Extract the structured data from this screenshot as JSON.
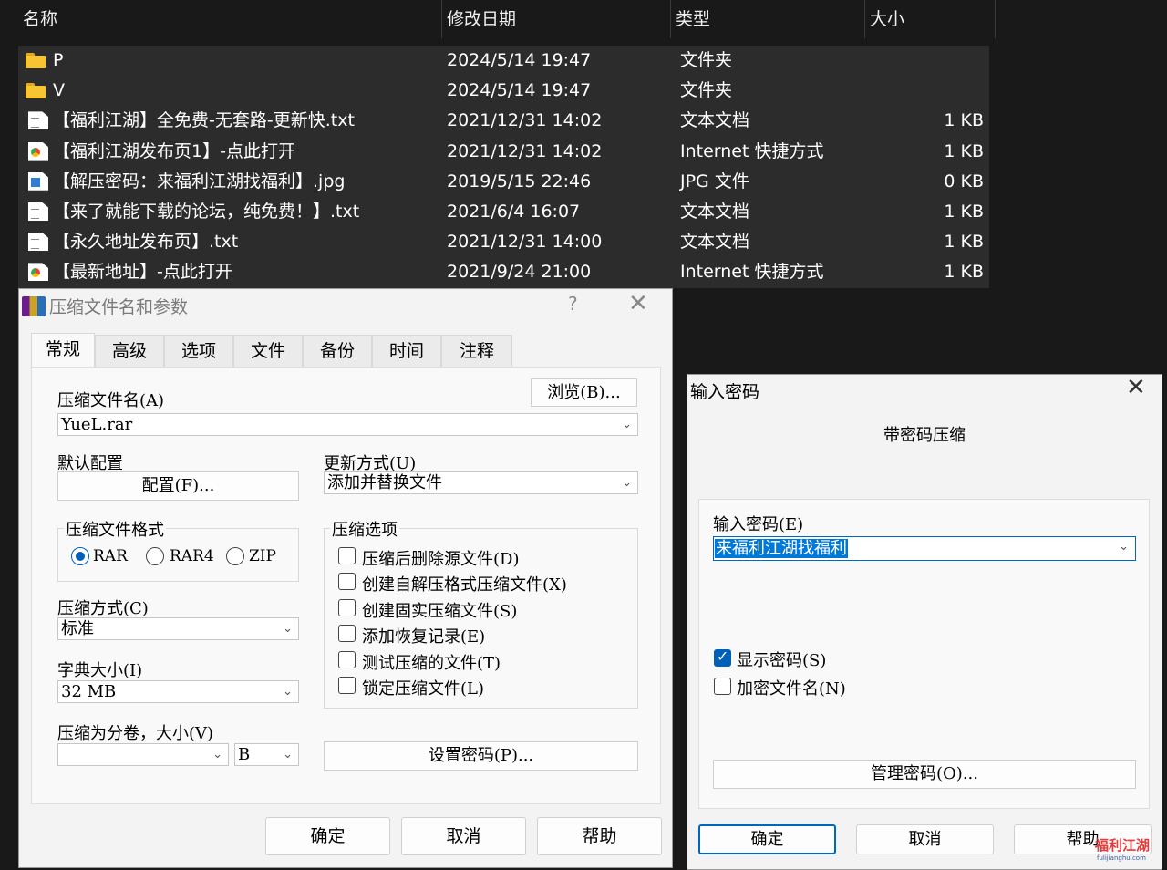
{
  "explorer": {
    "columns": {
      "name": "名称",
      "modified": "修改日期",
      "type": "类型",
      "size": "大小"
    },
    "files": [
      {
        "icon": "folder-icon",
        "name": "P",
        "date": "2024/5/14 19:47",
        "type": "文件夹",
        "size": ""
      },
      {
        "icon": "folder-icon",
        "name": "V",
        "date": "2024/5/14 19:47",
        "type": "文件夹",
        "size": ""
      },
      {
        "icon": "text-file-icon",
        "name": "【福利江湖】全免费-无套路-更新快.txt",
        "date": "2021/12/31 14:02",
        "type": "文本文档",
        "size": "1 KB"
      },
      {
        "icon": "internet-shortcut-icon",
        "name": "【福利江湖发布页1】-点此打开",
        "date": "2021/12/31 14:02",
        "type": "Internet 快捷方式",
        "size": "1 KB"
      },
      {
        "icon": "jpg-file-icon",
        "name": "【解压密码：来福利江湖找福利】.jpg",
        "date": "2019/5/15 22:46",
        "type": "JPG 文件",
        "size": "0 KB"
      },
      {
        "icon": "text-file-icon",
        "name": "【来了就能下载的论坛，纯免费！】.txt",
        "date": "2021/6/4 16:07",
        "type": "文本文档",
        "size": "1 KB"
      },
      {
        "icon": "text-file-icon",
        "name": "【永久地址发布页】.txt",
        "date": "2021/12/31 14:00",
        "type": "文本文档",
        "size": "1 KB"
      },
      {
        "icon": "internet-shortcut-icon",
        "name": "【最新地址】-点此打开",
        "date": "2021/9/24 21:00",
        "type": "Internet 快捷方式",
        "size": "1 KB"
      }
    ]
  },
  "rar_dialog": {
    "title": "压缩文件名和参数",
    "help": "?",
    "close": "✕",
    "tabs": [
      "常规",
      "高级",
      "选项",
      "文件",
      "备份",
      "时间",
      "注释"
    ],
    "archive_name_label": "压缩文件名(A)",
    "browse_button": "浏览(B)...",
    "archive_name_value": "YueL.rar",
    "default_profile_label": "默认配置",
    "profile_button": "配置(F)...",
    "update_mode_label": "更新方式(U)",
    "update_mode_value": "添加并替换文件",
    "format_group": "压缩文件格式",
    "formats": [
      "RAR",
      "RAR4",
      "ZIP"
    ],
    "selected_format": "RAR",
    "method_label": "压缩方式(C)",
    "method_value": "标准",
    "dict_label": "字典大小(I)",
    "dict_value": "32 MB",
    "split_label": "压缩为分卷，大小(V)",
    "split_value": "",
    "split_unit": "B",
    "options_group": "压缩选项",
    "options": [
      {
        "label": "压缩后删除源文件(D)",
        "checked": false
      },
      {
        "label": "创建自解压格式压缩文件(X)",
        "checked": false
      },
      {
        "label": "创建固实压缩文件(S)",
        "checked": false
      },
      {
        "label": "添加恢复记录(E)",
        "checked": false
      },
      {
        "label": "测试压缩的文件(T)",
        "checked": false
      },
      {
        "label": "锁定压缩文件(L)",
        "checked": false
      }
    ],
    "set_password_button": "设置密码(P)...",
    "ok": "确定",
    "cancel": "取消",
    "help_button": "帮助"
  },
  "password_dialog": {
    "title": "输入密码",
    "close": "✕",
    "subtitle": "带密码压缩",
    "enter_label": "输入密码(E)",
    "password_value": "来福利江湖找福利",
    "show_password": {
      "label": "显示密码(S)",
      "checked": true
    },
    "encrypt_names": {
      "label": "加密文件名(N)",
      "checked": false
    },
    "manage_button": "管理密码(O)...",
    "ok": "确定",
    "cancel": "取消",
    "help": "帮助"
  },
  "watermark": {
    "line1": "福利江湖",
    "line2": "fulijianghu.com"
  },
  "colors": {
    "accent": "#005fb8",
    "selection": "#0078d7",
    "explorer_bg": "#191919",
    "row_bg": "#2c2c2c"
  }
}
